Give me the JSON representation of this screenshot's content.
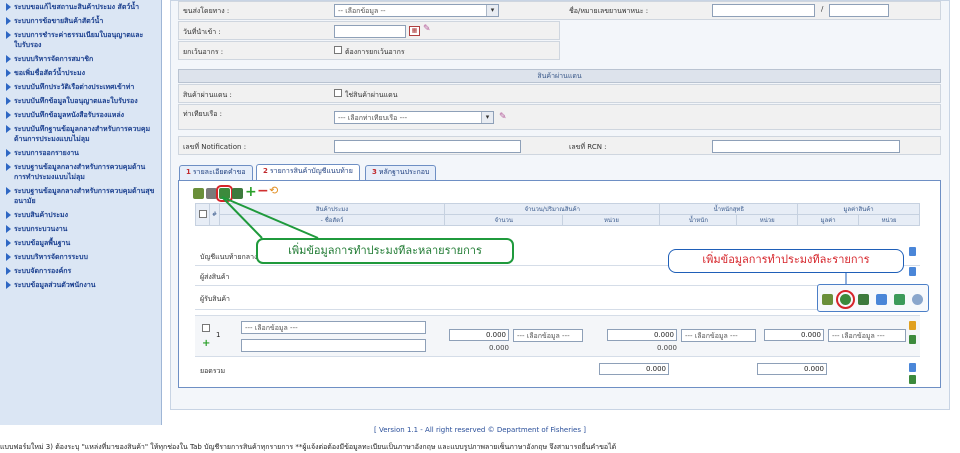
{
  "sidebar": {
    "items": [
      "ระบบขอแก้ไขสถานะสินค้าประมง สัตว์น้ำ",
      "ระบบการข้อขายสินค้าสัตว์น้ำ",
      "ระบบการชำระค่าธรรมเนียมใบอนุญาตและใบรับรอง",
      "ระบบบริหารจัดการสมาชิก",
      "ขอเพิ่มชื่อสัตว์น้ำประมง",
      "ระบบบันทึกประวัติเรือต่างประเทศเข้าท่า",
      "ระบบบันทึกข้อมูลใบอนุญาตและใบรับรอง",
      "ระบบบันทึกข้อมูลหนังสือรับรองแหล่ง",
      "ระบบบันทึกฐานข้อมูลกลางสำหรับการควบคุมด้านการประมงแบบไม่ลุม",
      "ระบบการออกรายงาน",
      "ระบบฐานข้อมูลกลางสำหรับการควบคุมด้านการทำประมงแบบไม่ลุม",
      "ระบบฐานข้อมูลกลางสำหรับการควบคุมด้านสุขอนามัย",
      "ระบบสินค้าประมง",
      "ระบบกระบวนงาน",
      "ระบบข้อมูลพื้นฐาน",
      "ระบบบริหารจัดการระบบ",
      "ระบบจัดการองค์กร",
      "ระบบข้อมูลส่วนตัวพนักงาน"
    ]
  },
  "form": {
    "ship_label": "ขนส่งโดยทาง :",
    "ship_select": "-- เลือกข้อมูล --",
    "vessel_label": "ชื่อ/หมายเลขยานพาหนะ :",
    "vessel_sep": "/",
    "import_date_label": "วันที่นำเข้า :",
    "import_date_icon": "calendar",
    "exempt_label": "ยกเว้นอากร :",
    "exempt_check": "ต้องการยกเว้นอากร"
  },
  "transit": {
    "section_title": "สินค้าผ่านแดน",
    "transit_label": "สินค้าผ่านแดน :",
    "transit_check": "ใช่สินค้าผ่านแดน",
    "port_label": "ท่าเทียบเรือ :",
    "port_select": "--- เลือกท่าเทียบเรือ ---",
    "notification_label": "เลขที่ Notification :",
    "rcn_label": "เลขที่ RCN :"
  },
  "tabs": [
    {
      "num": "1",
      "label": "รายละเอียดคำขอ"
    },
    {
      "num": "2",
      "label": "รายการสินค้าบัญชีแนบท้าย"
    },
    {
      "num": "3",
      "label": "หลักฐานประกอบ"
    }
  ],
  "grid": {
    "col_product": "สินค้าประมง",
    "col_hash": "#",
    "col_product_sub1": "-",
    "col_product_sub2": "ชื่อสัตว์",
    "col_qty": "จำนวน/ปริมาณสินค้า",
    "col_qty_amount": "จำนวน",
    "col_qty_unit": "หน่วย",
    "col_net": "น้ำหนักสุทธิ",
    "col_net_weight": "น้ำหนัก",
    "col_net_unit": "หน่วย",
    "col_value": "มูลค่าสินค้า",
    "col_value_amount": "มูลค่า",
    "col_value_unit": "หน่วย",
    "label_attachment": "บัญชีแนบท้ายกลาง",
    "label_sender": "ผู้ส่งสินค้า",
    "label_receiver": "ผู้รับสินค้า",
    "row_no": "1",
    "row_select_product": "--- เลือกข้อมูล ---",
    "qty_value": "0.000",
    "qty_sub": "0.000",
    "qty_unit_select": "--- เลือกข้อมูล ---",
    "net_value": "0.000",
    "net_sub": "0.000",
    "net_unit_select": "--- เลือกข้อมูล ---",
    "val_value": "0.000",
    "val_unit_select": "--- เลือกข้อมูล ---",
    "total_label": "ยอดรวม",
    "total_net": "0.000",
    "total_val": "0.000"
  },
  "annotations": {
    "callout_multi": "เพิ่มข้อมูลการทำประมงทีละหลายรายการ",
    "callout_single": "เพิ่มข้อมูลการทำประมงทีละรายการ",
    "color_green": "#1f9a3c",
    "color_red": "#d6242a"
  },
  "footer": {
    "version": "[ Version 1.1 - All right reserved © Department of Fisheries ]",
    "note": "แบบฟอร์มใหม่ 3) ต้องระบุ \"แหล่งที่มาของสินค้า\" ให้ทุกช่องใน Tab บัญชีรายการสินค้าทุกรายการ **ผู้แจ้งต่อต้องมีข้อมูลทะเบียนเป็นภาษาอังกฤษ และแบบรูปภาพลายเซ็นภาษาอังกฤษ จึงสามารถยื่นคำขอได้"
  }
}
